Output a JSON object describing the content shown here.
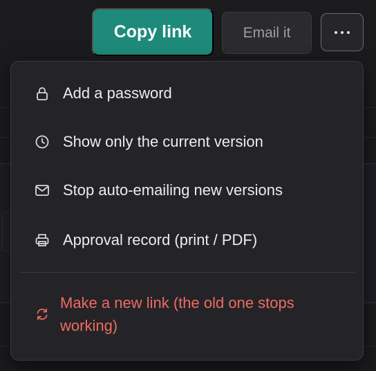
{
  "toolbar": {
    "copy_label": "Copy link",
    "email_label": "Email it",
    "more_icon": "ellipsis-icon"
  },
  "menu": {
    "items": [
      {
        "label": "Add a password",
        "icon": "lock-icon"
      },
      {
        "label": "Show only the current version",
        "icon": "clock-icon"
      },
      {
        "label": "Stop auto-emailing new versions",
        "icon": "mail-icon"
      },
      {
        "label": "Approval record (print / PDF)",
        "icon": "printer-icon"
      }
    ],
    "danger_item": {
      "label": "Make a new link (the old one stops working)",
      "icon": "refresh-icon"
    }
  },
  "colors": {
    "accent": "#1e8a7c",
    "danger": "#ef6b62",
    "menu_bg": "#242428"
  }
}
